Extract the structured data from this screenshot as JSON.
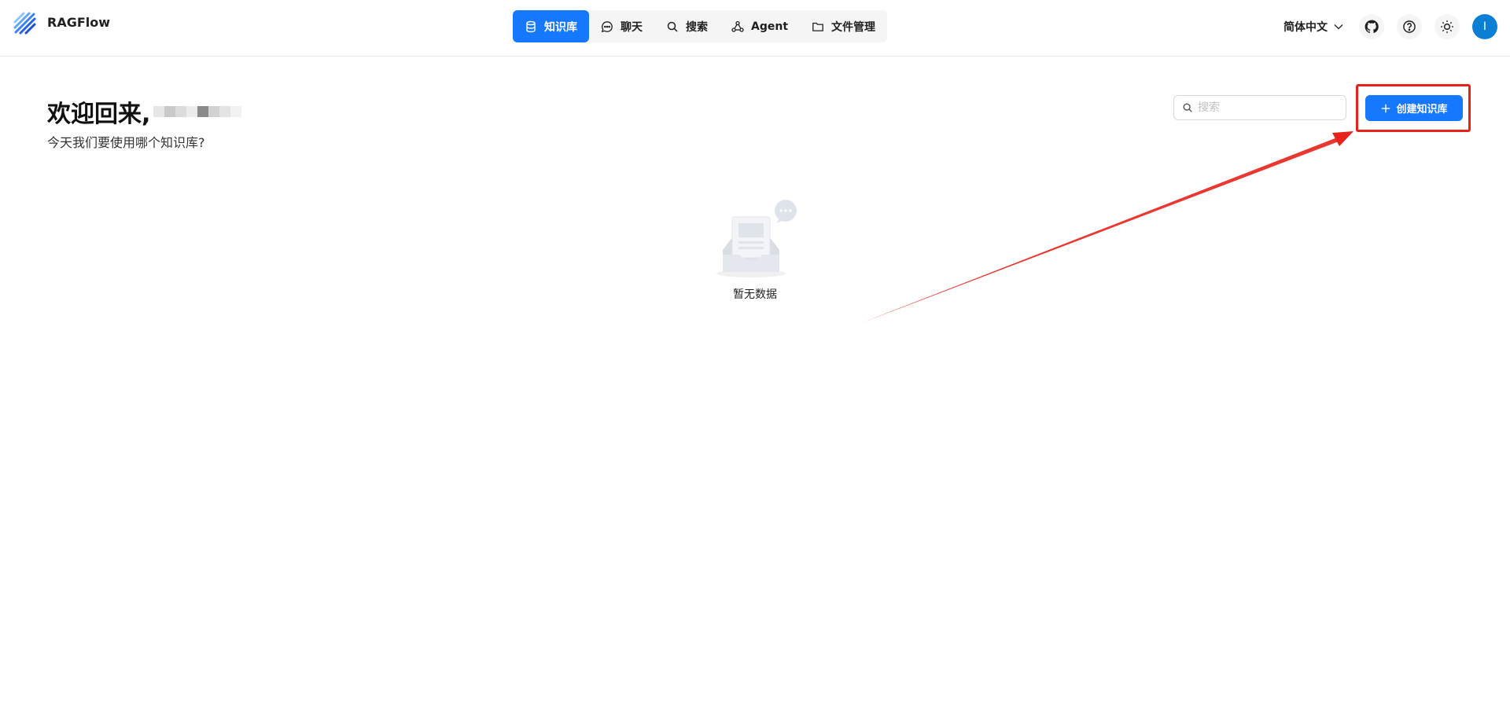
{
  "brand": {
    "name": "RAGFlow"
  },
  "nav": {
    "items": [
      {
        "label": "知识库",
        "icon": "database-icon",
        "active": true
      },
      {
        "label": "聊天",
        "icon": "chat-bubble-icon",
        "active": false
      },
      {
        "label": "搜索",
        "icon": "search-icon",
        "active": false
      },
      {
        "label": "Agent",
        "icon": "agent-graph-icon",
        "active": false
      },
      {
        "label": "文件管理",
        "icon": "folder-icon",
        "active": false
      }
    ]
  },
  "header_tools": {
    "language": "简体中文",
    "avatar_initial": "I"
  },
  "main": {
    "welcome_title": "欢迎回来,",
    "welcome_subtitle": "今天我们要使用哪个知识库?",
    "search_placeholder": "搜索",
    "create_button_label": "创建知识库",
    "empty_text": "暂无数据"
  },
  "colors": {
    "accent": "#1677ff",
    "highlight": "#e8221a",
    "avatar": "#0a7fd3"
  }
}
